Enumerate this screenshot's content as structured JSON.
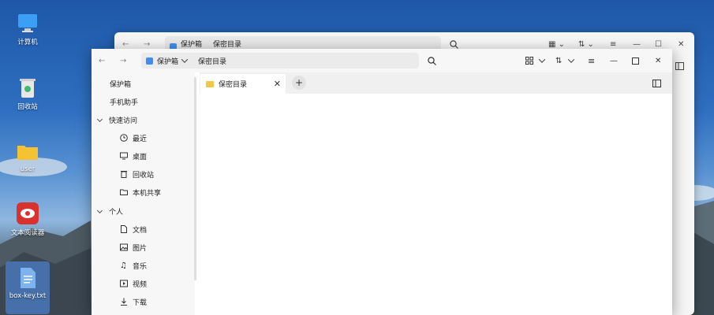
{
  "desktop": {
    "icons": [
      {
        "label": "计算机",
        "icon": "computer-icon"
      },
      {
        "label": "回收站",
        "icon": "trash-icon"
      },
      {
        "label": "user",
        "icon": "folder-icon"
      },
      {
        "label": "文本阅读器",
        "icon": "reader-app-icon"
      },
      {
        "label": "box-key.txt",
        "icon": "text-file-icon"
      }
    ]
  },
  "back_window": {
    "crumb1": "保护箱",
    "crumb2": "保密目录"
  },
  "window": {
    "breadcrumb": {
      "root": "保护箱",
      "current": "保密目录"
    },
    "sidebar": {
      "top_items": [
        "保护箱",
        "手机助手"
      ],
      "quick_access": {
        "label": "快速访问",
        "items": [
          {
            "label": "最近",
            "icon": "clock-icon"
          },
          {
            "label": "桌面",
            "icon": "monitor-icon"
          },
          {
            "label": "回收站",
            "icon": "trash-icon"
          },
          {
            "label": "本机共享",
            "icon": "folder-share-icon"
          }
        ]
      },
      "personal": {
        "label": "个人",
        "items": [
          {
            "label": "文档",
            "icon": "document-icon"
          },
          {
            "label": "图片",
            "icon": "image-icon"
          },
          {
            "label": "音乐",
            "icon": "music-icon"
          },
          {
            "label": "视频",
            "icon": "video-icon"
          },
          {
            "label": "下载",
            "icon": "download-icon"
          }
        ]
      }
    },
    "tabs": [
      {
        "label": "保密目录",
        "active": true
      }
    ],
    "add_tab_symbol": "+",
    "close_tab_symbol": "✕"
  },
  "colors": {
    "accent": "#3d8ef0",
    "folder": "#f2c744"
  }
}
